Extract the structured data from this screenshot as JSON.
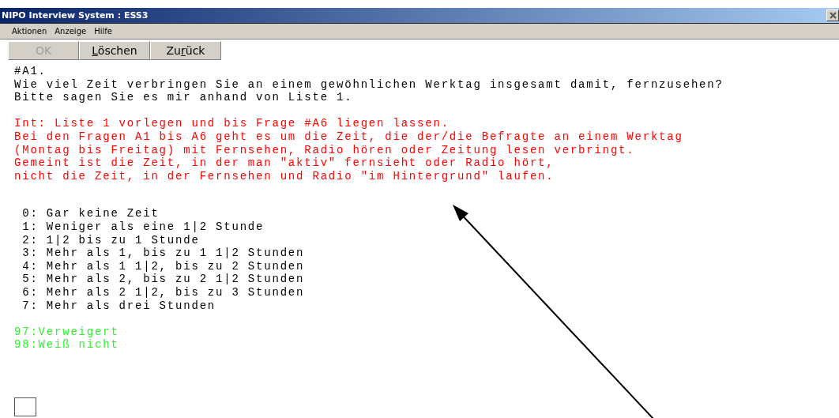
{
  "window": {
    "title": "NIPO Interview System : ESS3"
  },
  "menu": [
    "Aktionen",
    "Anzeige",
    "Hilfe"
  ],
  "buttons": [
    {
      "before": "OK",
      "disabled": true
    },
    {
      "key": "L",
      "after": "öschen",
      "disabled": false
    },
    {
      "before": "Zu",
      "key": "r",
      "after": "ück",
      "disabled": false
    }
  ],
  "question": {
    "id": "#A1.",
    "lines": [
      "Wie viel Zeit verbringen Sie an einem gewöhnlichen Werktag insgesamt damit, fernzusehen?",
      "Bitte sagen Sie es mir anhand von Liste 1."
    ]
  },
  "instructions": [
    "Int: Liste 1 vorlegen und bis Frage #A6 liegen lassen.",
    "Bei den Fragen A1 bis A6 geht es um die Zeit, die der/die Befragte an einem Werktag",
    "(Montag bis Freitag) mit Fernsehen, Radio hören oder Zeitung lesen verbringt.",
    "Gemeint ist die Zeit, in der man \"aktiv\" fernsieht oder Radio hört,",
    "nicht die Zeit, in der Fernsehen und Radio \"im Hintergrund\" laufen."
  ],
  "answers": [
    " 0: Gar keine Zeit",
    " 1: Weniger als eine 1|2 Stunde",
    " 2: 1|2 bis zu 1 Stunde",
    " 3: Mehr als 1, bis zu 1 1|2 Stunden",
    " 4: Mehr als 1 1|2, bis zu 2 Stunden",
    " 5: Mehr als 2, bis zu 2 1|2 Stunden",
    " 6: Mehr als 2 1|2, bis zu 3 Stunden",
    " 7: Mehr als drei Stunden"
  ],
  "special_answers": [
    "97:Verweigert",
    "98:Weiß nicht"
  ]
}
